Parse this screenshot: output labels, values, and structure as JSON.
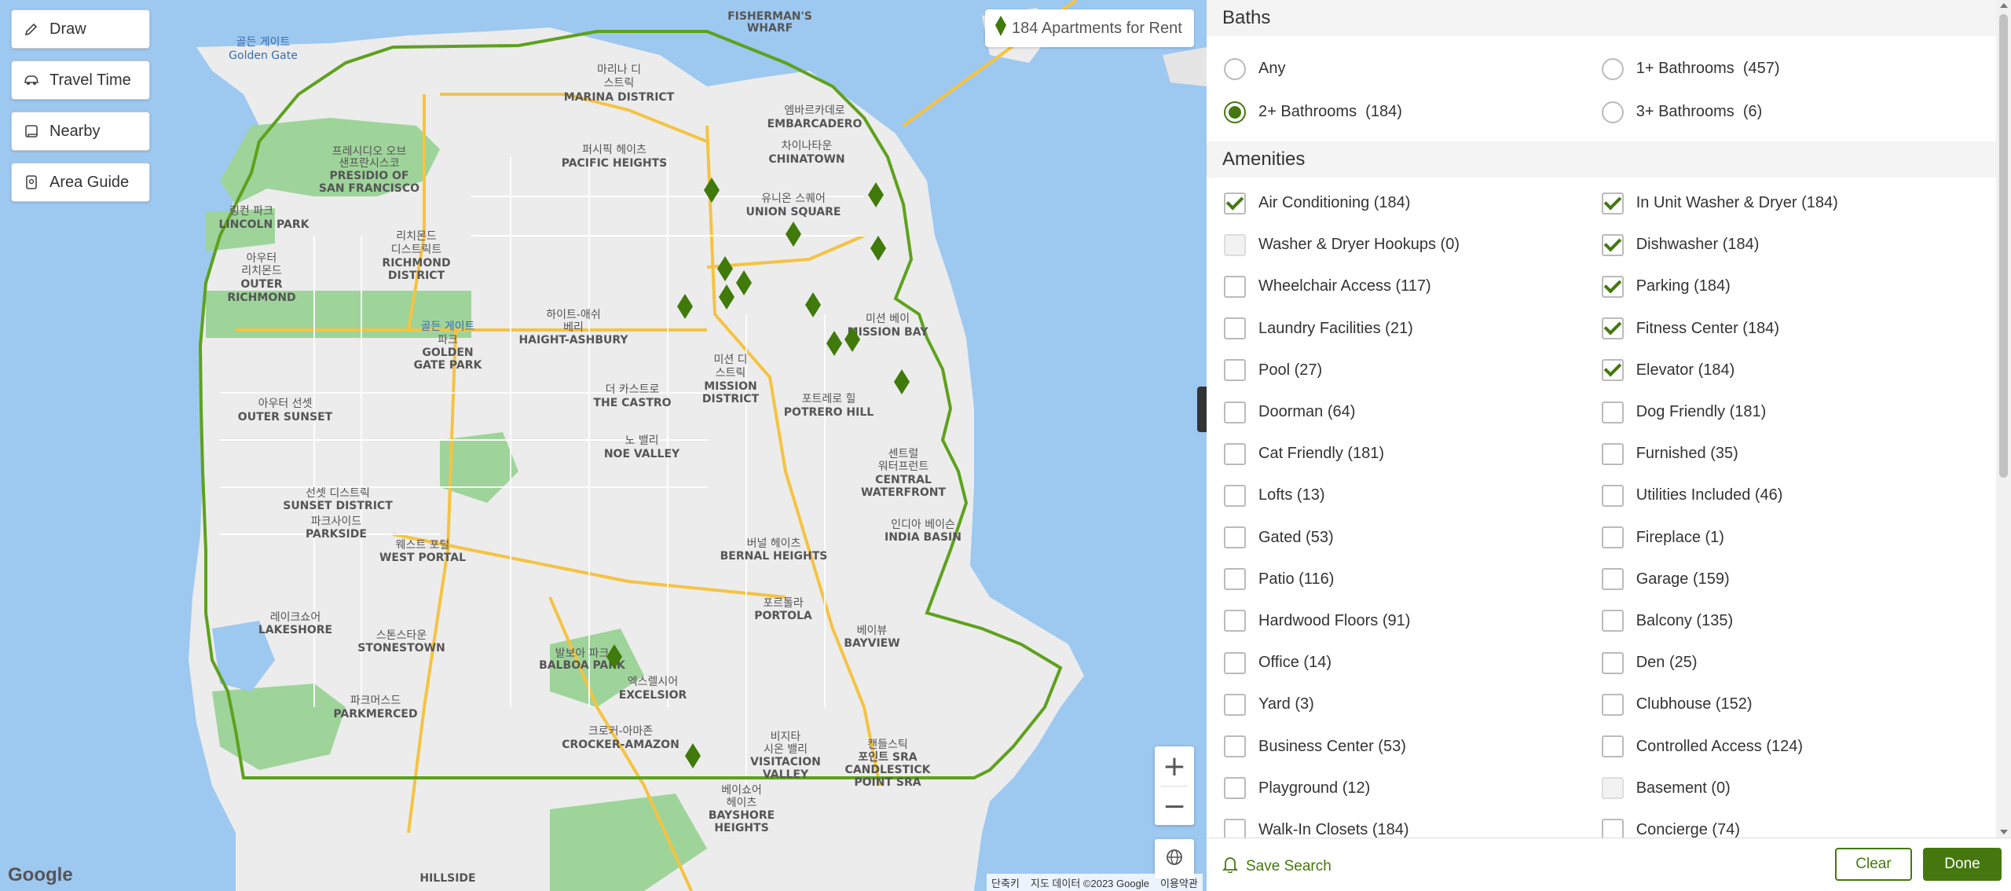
{
  "map": {
    "buttons": [
      {
        "label": "Draw",
        "icon": "pencil-icon"
      },
      {
        "label": "Travel Time",
        "icon": "car-icon"
      },
      {
        "label": "Nearby",
        "icon": "square-icon"
      },
      {
        "label": "Area Guide",
        "icon": "guide-icon"
      }
    ],
    "count_label": "184 Apartments for Rent",
    "labels": [
      {
        "t": "골든 게이트"
      },
      {
        "t": "Golden Gate"
      },
      {
        "t": "마리나 디"
      },
      {
        "t": "스트릭"
      },
      {
        "t": "MARINA DISTRICT"
      },
      {
        "t": "FISHERMAN'S"
      },
      {
        "t": "WHARF"
      },
      {
        "t": "프레시디오 오브"
      },
      {
        "t": "샌프란시스코"
      },
      {
        "t": "PRESIDIO OF"
      },
      {
        "t": "SAN FRANCISCO"
      },
      {
        "t": "퍼시픽 헤이츠"
      },
      {
        "t": "PACIFIC HEIGHTS"
      },
      {
        "t": "엠바르카데로"
      },
      {
        "t": "EMBARCADERO"
      },
      {
        "t": "차이나타운"
      },
      {
        "t": "CHINATOWN"
      },
      {
        "t": "링컨 파크"
      },
      {
        "t": "LINCOLN PARK"
      },
      {
        "t": "리치몬드"
      },
      {
        "t": "디스트릭트"
      },
      {
        "t": "RICHMOND"
      },
      {
        "t": "DISTRICT"
      },
      {
        "t": "유니온 스퀘어"
      },
      {
        "t": "UNION SQUARE"
      },
      {
        "t": "아우터"
      },
      {
        "t": "리치몬드"
      },
      {
        "t": "OUTER"
      },
      {
        "t": "RICHMOND"
      },
      {
        "t": "하이트-애쉬"
      },
      {
        "t": "베리"
      },
      {
        "t": "HAIGHT-ASHBURY"
      },
      {
        "t": "골든 게이트"
      },
      {
        "t": "파크"
      },
      {
        "t": "GOLDEN"
      },
      {
        "t": "GATE PARK"
      },
      {
        "t": "미션 베이"
      },
      {
        "t": "MISSION BAY"
      },
      {
        "t": "미션 디"
      },
      {
        "t": "스트릭"
      },
      {
        "t": "MISSION"
      },
      {
        "t": "DISTRICT"
      },
      {
        "t": "더 카스트로"
      },
      {
        "t": "THE CASTRO"
      },
      {
        "t": "포트레로 힐"
      },
      {
        "t": "POTRERO HILL"
      },
      {
        "t": "아우터 선셋"
      },
      {
        "t": "OUTER SUNSET"
      },
      {
        "t": "노 밸리"
      },
      {
        "t": "NOE VALLEY"
      },
      {
        "t": "센트럴"
      },
      {
        "t": "워터프런트"
      },
      {
        "t": "CENTRAL"
      },
      {
        "t": "WATERFRONT"
      },
      {
        "t": "선셋 디스트릭"
      },
      {
        "t": "SUNSET DISTRICT"
      },
      {
        "t": "파크사이드"
      },
      {
        "t": "PARKSIDE"
      },
      {
        "t": "인디아 베이슨"
      },
      {
        "t": "INDIA BASIN"
      },
      {
        "t": "웨스트 포털"
      },
      {
        "t": "WEST PORTAL"
      },
      {
        "t": "버널 헤이츠"
      },
      {
        "t": "BERNAL HEIGHTS"
      },
      {
        "t": "포르톨라"
      },
      {
        "t": "PORTOLA"
      },
      {
        "t": "레이크쇼어"
      },
      {
        "t": "LAKESHORE"
      },
      {
        "t": "스톤스타운"
      },
      {
        "t": "STONESTOWN"
      },
      {
        "t": "베이뷰"
      },
      {
        "t": "BAYVIEW"
      },
      {
        "t": "발보아 파크"
      },
      {
        "t": "BALBOA PARK"
      },
      {
        "t": "엑스렐시어"
      },
      {
        "t": "EXCELSIOR"
      },
      {
        "t": "파크머스드"
      },
      {
        "t": "PARKMERCED"
      },
      {
        "t": "크로커-아마존"
      },
      {
        "t": "CROCKER-AMAZON"
      },
      {
        "t": "비지타"
      },
      {
        "t": "시온 밸리"
      },
      {
        "t": "VISITACION"
      },
      {
        "t": "VALLEY"
      },
      {
        "t": "캔들스틱"
      },
      {
        "t": "포인트 SRA"
      },
      {
        "t": "CANDLESTICK"
      },
      {
        "t": "POINT SRA"
      },
      {
        "t": "베이쇼어"
      },
      {
        "t": "헤이츠"
      },
      {
        "t": "BAYSHORE"
      },
      {
        "t": "HEIGHTS"
      },
      {
        "t": "HILLSIDE"
      }
    ],
    "google": "Google",
    "attribution": [
      "단축키",
      "지도 데이터 ©2023 Google",
      "이용약관"
    ],
    "colors": {
      "pin": "#3f7a0a",
      "boundary": "#5ea11d",
      "accent": "#44780f"
    }
  },
  "panel": {
    "baths": {
      "title": "Baths",
      "options": [
        {
          "label": "Any",
          "selected": false
        },
        {
          "label": "1+ Bathrooms  (457)",
          "selected": false
        },
        {
          "label": "2+ Bathrooms  (184)",
          "selected": true
        },
        {
          "label": "3+ Bathrooms  (6)",
          "selected": false
        }
      ]
    },
    "amenities": {
      "title": "Amenities",
      "items": [
        {
          "label": "Air Conditioning (184)",
          "checked": true
        },
        {
          "label": "In Unit Washer & Dryer (184)",
          "checked": true
        },
        {
          "label": "Washer & Dryer Hookups (0)",
          "checked": false,
          "disabled": true
        },
        {
          "label": "Dishwasher (184)",
          "checked": true
        },
        {
          "label": "Wheelchair Access (117)",
          "checked": false
        },
        {
          "label": "Parking (184)",
          "checked": true
        },
        {
          "label": "Laundry Facilities (21)",
          "checked": false
        },
        {
          "label": "Fitness Center (184)",
          "checked": true
        },
        {
          "label": "Pool (27)",
          "checked": false
        },
        {
          "label": "Elevator (184)",
          "checked": true
        },
        {
          "label": "Doorman (64)",
          "checked": false
        },
        {
          "label": "Dog Friendly (181)",
          "checked": false
        },
        {
          "label": "Cat Friendly (181)",
          "checked": false
        },
        {
          "label": "Furnished (35)",
          "checked": false
        },
        {
          "label": "Lofts (13)",
          "checked": false
        },
        {
          "label": "Utilities Included (46)",
          "checked": false
        },
        {
          "label": "Gated (53)",
          "checked": false
        },
        {
          "label": "Fireplace (1)",
          "checked": false
        },
        {
          "label": "Patio (116)",
          "checked": false
        },
        {
          "label": "Garage (159)",
          "checked": false
        },
        {
          "label": "Hardwood Floors (91)",
          "checked": false
        },
        {
          "label": "Balcony (135)",
          "checked": false
        },
        {
          "label": "Office (14)",
          "checked": false
        },
        {
          "label": "Den (25)",
          "checked": false
        },
        {
          "label": "Yard (3)",
          "checked": false
        },
        {
          "label": "Clubhouse (152)",
          "checked": false
        },
        {
          "label": "Business Center (53)",
          "checked": false
        },
        {
          "label": "Controlled Access (124)",
          "checked": false
        },
        {
          "label": "Playground (12)",
          "checked": false
        },
        {
          "label": "Basement (0)",
          "checked": false,
          "disabled": true
        },
        {
          "label": "Walk-In Closets (184)",
          "checked": false
        },
        {
          "label": "Concierge (74)",
          "checked": false
        }
      ]
    },
    "footer": {
      "save_search": "Save Search",
      "clear": "Clear",
      "done": "Done"
    }
  }
}
